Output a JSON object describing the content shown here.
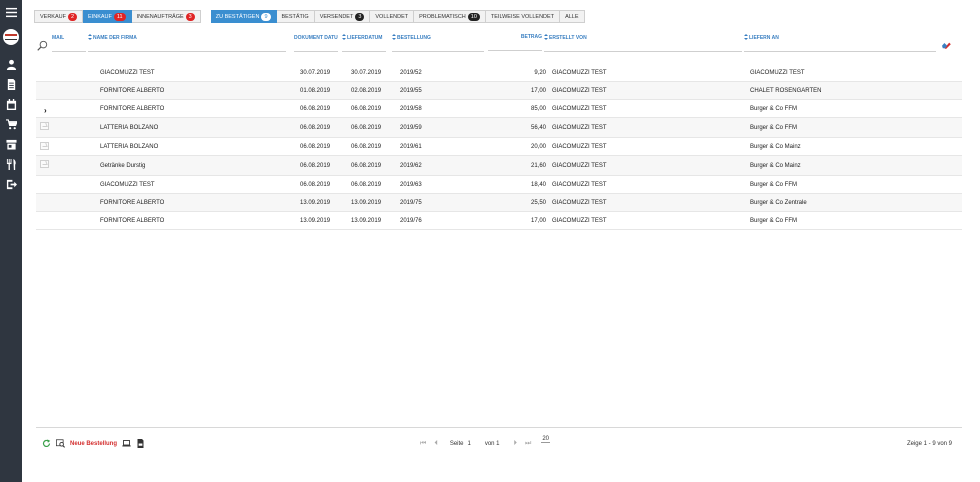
{
  "tabs": [
    {
      "label": "Verkauf",
      "badge": "2",
      "badge_style": "red",
      "active": false
    },
    {
      "label": "Einkauf",
      "badge": "11",
      "badge_style": "red",
      "active": true
    },
    {
      "label": "Innenaufträge",
      "badge": "3",
      "badge_style": "red",
      "active": false
    },
    {
      "label": "Zu bestätigen",
      "badge": "9",
      "badge_style": "blue",
      "active": true
    },
    {
      "label": "Bestätig",
      "badge": "",
      "badge_style": "",
      "active": false
    },
    {
      "label": "Versendet",
      "badge": "3",
      "badge_style": "dark",
      "active": false
    },
    {
      "label": "Vollendet",
      "badge": "",
      "badge_style": "",
      "active": false
    },
    {
      "label": "Problematisch",
      "badge": "10",
      "badge_style": "dark",
      "active": false
    },
    {
      "label": "Teilweise vollendet",
      "badge": "",
      "badge_style": "",
      "active": false
    },
    {
      "label": "Alle",
      "badge": "",
      "badge_style": "",
      "active": false
    }
  ],
  "columns": {
    "mail": "MAIL",
    "company": "NAME DER FIRMA",
    "doc_date": "DOKUMENT DATU",
    "delivery_date": "LIEFERDATUM",
    "order": "BESTELLUNG",
    "amount": "BETRAG",
    "created_by": "ERSTELLT VON",
    "deliver_to": "LIEFERN AN"
  },
  "rows": [
    {
      "company": "GIACOMUZZI TEST",
      "doc_date": "30.07.2019",
      "delivery_date": "30.07.2019",
      "order": "2019/52",
      "amount": "9,20",
      "created_by": "GIACOMUZZI TEST",
      "deliver_to": "GIACOMUZZI TEST",
      "mail": false,
      "selected": false
    },
    {
      "company": "FORNITORE ALBERTO",
      "doc_date": "01.08.2019",
      "delivery_date": "02.08.2019",
      "order": "2019/55",
      "amount": "17,00",
      "created_by": "GIACOMUZZI TEST",
      "deliver_to": "CHALET ROSENGARTEN",
      "mail": false,
      "selected": false
    },
    {
      "company": "FORNITORE ALBERTO",
      "doc_date": "06.08.2019",
      "delivery_date": "06.08.2019",
      "order": "2019/58",
      "amount": "85,00",
      "created_by": "GIACOMUZZI TEST",
      "deliver_to": "Burger & Co FFM",
      "mail": false,
      "selected": true
    },
    {
      "company": "LATTERIA BOLZANO",
      "doc_date": "06.08.2019",
      "delivery_date": "06.08.2019",
      "order": "2019/59",
      "amount": "56,40",
      "created_by": "GIACOMUZZI TEST",
      "deliver_to": "Burger & Co FFM",
      "mail": true,
      "selected": false
    },
    {
      "company": "LATTERIA BOLZANO",
      "doc_date": "06.08.2019",
      "delivery_date": "06.08.2019",
      "order": "2019/61",
      "amount": "20,00",
      "created_by": "GIACOMUZZI TEST",
      "deliver_to": "Burger & Co Mainz",
      "mail": true,
      "selected": false
    },
    {
      "company": "Getränke Durstig",
      "doc_date": "06.08.2019",
      "delivery_date": "06.08.2019",
      "order": "2019/62",
      "amount": "21,60",
      "created_by": "GIACOMUZZI TEST",
      "deliver_to": "Burger & Co Mainz",
      "mail": true,
      "selected": false
    },
    {
      "company": "GIACOMUZZI TEST",
      "doc_date": "06.08.2019",
      "delivery_date": "06.08.2019",
      "order": "2019/63",
      "amount": "18,40",
      "created_by": "GIACOMUZZI TEST",
      "deliver_to": "Burger & Co FFM",
      "mail": false,
      "selected": false
    },
    {
      "company": "FORNITORE ALBERTO",
      "doc_date": "13.09.2019",
      "delivery_date": "13.09.2019",
      "order": "2019/75",
      "amount": "25,50",
      "created_by": "GIACOMUZZI TEST",
      "deliver_to": "Burger & Co Zentrale",
      "mail": false,
      "selected": false
    },
    {
      "company": "FORNITORE ALBERTO",
      "doc_date": "13.09.2019",
      "delivery_date": "13.09.2019",
      "order": "2019/76",
      "amount": "17,00",
      "created_by": "GIACOMUZZI TEST",
      "deliver_to": "Burger & Co FFM",
      "mail": false,
      "selected": false
    }
  ],
  "footer": {
    "new_order": "Neue Bestellung",
    "page_label": "Seite",
    "page_value": "1",
    "of_pages": "von 1",
    "page_size": "20",
    "summary": "Zeige 1 - 9 von 9"
  },
  "colors": {
    "accent": "#3a8ed0",
    "badge_red": "#e02424",
    "sidebar": "#2f3640",
    "new_order": "#d32f2f"
  },
  "sidebar_icons": [
    "menu-icon",
    "user-icon",
    "document-icon",
    "calendar-icon",
    "cart-icon",
    "store-icon",
    "cutlery-icon",
    "logout-icon"
  ]
}
